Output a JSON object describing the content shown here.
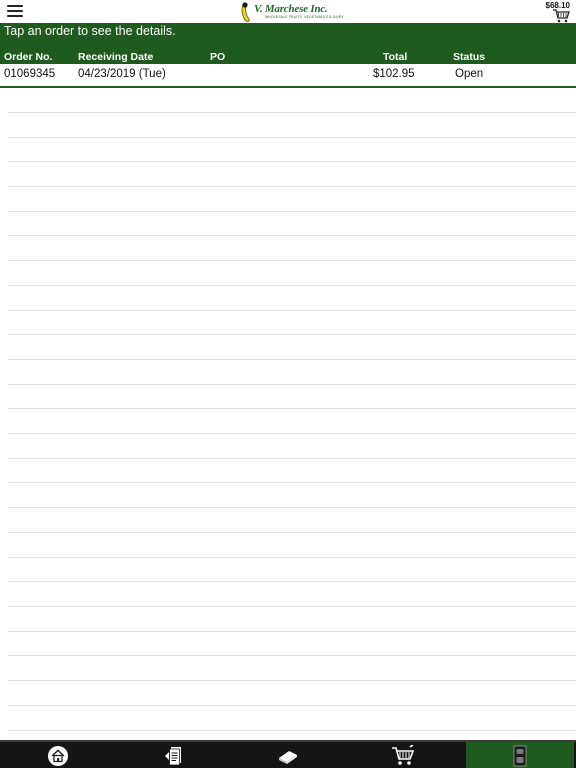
{
  "header": {
    "logo_text": "V. Marchese Inc.",
    "logo_sub": "WHOLESALE FRUITS, VEGETABLES & DAIRY",
    "cart_total": "$68.10"
  },
  "hint": "Tap an order to see the details.",
  "table": {
    "columns": [
      "Order No.",
      "Receiving Date",
      "PO",
      "Total",
      "Status"
    ],
    "rows": [
      {
        "order_no": "01069345",
        "receiving_date": "04/23/2019 (Tue)",
        "po": "",
        "total": "$102.95",
        "status": "Open"
      }
    ]
  },
  "tabbar": {
    "tabs": [
      {
        "name": "home",
        "icon": "home-icon"
      },
      {
        "name": "order-guide",
        "icon": "documents-icon"
      },
      {
        "name": "catalog",
        "icon": "book-icon"
      },
      {
        "name": "cart",
        "icon": "cart-icon"
      },
      {
        "name": "orders",
        "icon": "orders-icon",
        "active": true
      }
    ]
  },
  "colors": {
    "brand_green": "#1f5b1f",
    "tabbar_bg": "#151515"
  }
}
